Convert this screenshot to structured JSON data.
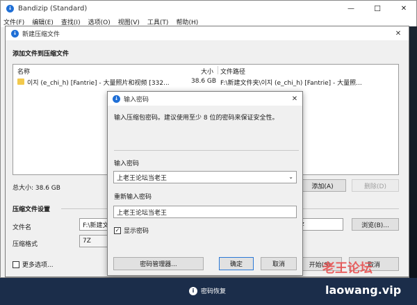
{
  "app": {
    "title": "Bandizip (Standard)",
    "menu": [
      "文件(F)",
      "编辑(E)",
      "查找(I)",
      "选项(O)",
      "视图(V)",
      "工具(T)",
      "帮助(H)"
    ],
    "min_glyph": "—",
    "max_glyph": "☐",
    "close_glyph": "✕"
  },
  "compress": {
    "title": "新建压缩文件",
    "section_add": "添加文件到压缩文件",
    "columns": {
      "name": "名称",
      "size": "大小",
      "path": "文件路径"
    },
    "files": [
      {
        "name": "이지 (e_chi_h) [Fantrie] - 大量照片和视频 [332...",
        "size": "38.6 GB",
        "path": "F:\\新建文件夹\\이지 (e_chi_h) [Fantrie] - 大量照..."
      }
    ],
    "total_size": "总大小: 38.6 GB",
    "add_button": "添加(A)",
    "delete_button": "删除(D)",
    "settings_title": "压缩文件设置",
    "filename_label": "文件名",
    "filename_value": "F:\\新建文",
    "filename_ext": "z",
    "browse_button": "浏览(B)...",
    "format_label": "压缩格式",
    "format_value": "7Z",
    "more_options": "更多选项...",
    "start_button": "开始(S)",
    "cancel_button": "取消"
  },
  "password": {
    "title": "输入密码",
    "description": "输入压缩包密码。建议使用至少 8 位的密码来保证安全性。",
    "enter_label": "输入密码",
    "enter_value": "上老王论坛当老王",
    "reenter_label": "重新输入密码",
    "reenter_value": "上老王论坛当老王",
    "show_password": "显示密码",
    "show_checked": "✓",
    "manager_button": "密码管理器...",
    "ok_button": "确定",
    "cancel_button": "取消"
  },
  "statusbar": {
    "recovery": "密码恢复"
  },
  "watermark": {
    "title": "老王论坛",
    "url": "laowang.vip"
  },
  "colors": {
    "accent": "#1f6fd6",
    "statusbar": "#1b2d4a",
    "watermark": "#e84a4a"
  }
}
